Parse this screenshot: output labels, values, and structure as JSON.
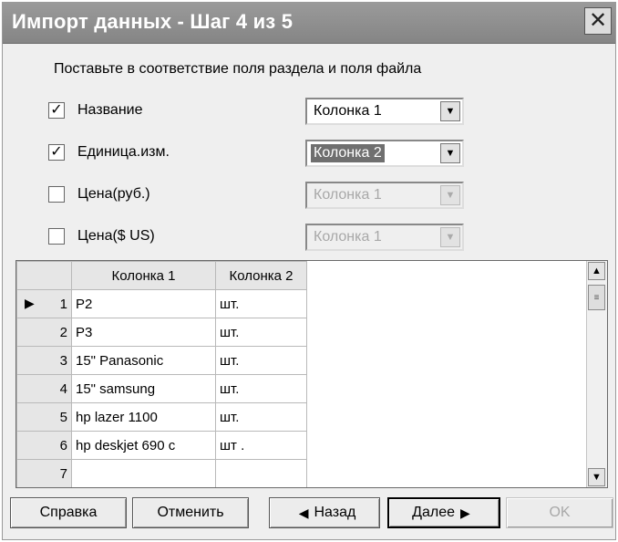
{
  "window": {
    "title": "Импорт данных - Шаг 4 из 5",
    "close_label": "✕"
  },
  "instruction": "Поставьте в соответствие поля раздела и поля файла",
  "fields": [
    {
      "label": "Название",
      "checked": true,
      "checkmark": "✓",
      "select_value": "Колонка 1",
      "enabled": true,
      "highlighted": false
    },
    {
      "label": "Единица.изм.",
      "checked": true,
      "checkmark": "✓",
      "select_value": "Колонка 2",
      "enabled": true,
      "highlighted": true
    },
    {
      "label": "Цена(руб.)",
      "checked": false,
      "checkmark": "",
      "select_value": "Колонка 1",
      "enabled": false,
      "highlighted": false
    },
    {
      "label": "Цена($ US)",
      "checked": false,
      "checkmark": "",
      "select_value": "Колонка 1",
      "enabled": false,
      "highlighted": false
    }
  ],
  "grid": {
    "columns": [
      "Колонка 1",
      "Колонка 2"
    ],
    "rows": [
      {
        "num": "1",
        "c1": "P2",
        "c2": "шт.",
        "current": true
      },
      {
        "num": "2",
        "c1": "P3",
        "c2": "шт.",
        "current": false
      },
      {
        "num": "3",
        "c1": "15\" Panasonic",
        "c2": "шт.",
        "current": false
      },
      {
        "num": "4",
        "c1": "15\" samsung",
        "c2": "шт.",
        "current": false
      },
      {
        "num": "5",
        "c1": "hp   lazer 1100",
        "c2": "шт.",
        "current": false
      },
      {
        "num": "6",
        "c1": "hp   deskjet 690 c",
        "c2": "шт .",
        "current": false
      },
      {
        "num": "7",
        "c1": "",
        "c2": "",
        "current": false
      }
    ],
    "current_row_marker": "▶"
  },
  "buttons": {
    "help": "Справка",
    "cancel": "Отменить",
    "back": "Назад",
    "back_arrow": "◀",
    "next": "Далее",
    "next_arrow": "▶",
    "ok": "OK"
  },
  "icons": {
    "dropdown_arrow": "▼",
    "scroll_up": "▲",
    "scroll_down": "▼",
    "scroll_grip": "≡"
  }
}
